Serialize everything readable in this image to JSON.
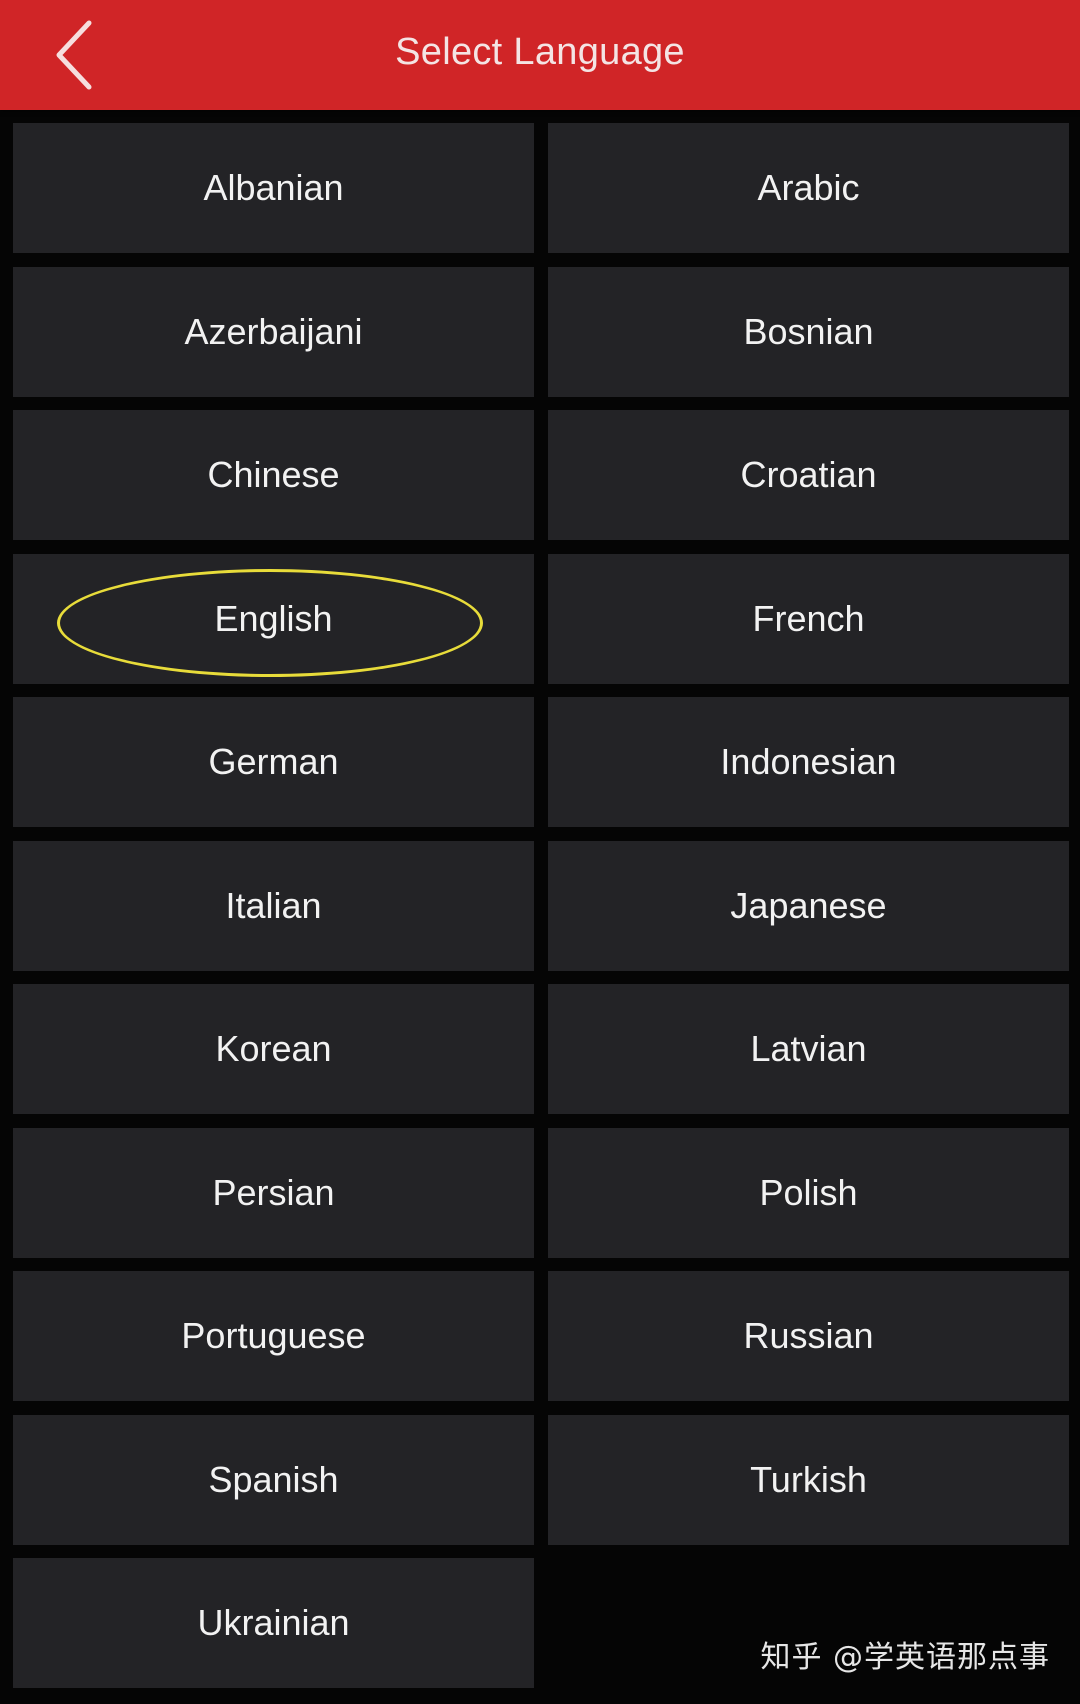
{
  "header": {
    "title": "Select Language",
    "background_color": "#d02527",
    "back_icon": "chevron-left-icon"
  },
  "languages": [
    {
      "label": "Albanian",
      "highlighted": false
    },
    {
      "label": "Arabic",
      "highlighted": false
    },
    {
      "label": "Azerbaijani",
      "highlighted": false
    },
    {
      "label": "Bosnian",
      "highlighted": false
    },
    {
      "label": "Chinese",
      "highlighted": false
    },
    {
      "label": "Croatian",
      "highlighted": false
    },
    {
      "label": "English",
      "highlighted": true
    },
    {
      "label": "French",
      "highlighted": false
    },
    {
      "label": "German",
      "highlighted": false
    },
    {
      "label": "Indonesian",
      "highlighted": false
    },
    {
      "label": "Italian",
      "highlighted": false
    },
    {
      "label": "Japanese",
      "highlighted": false
    },
    {
      "label": "Korean",
      "highlighted": false
    },
    {
      "label": "Latvian",
      "highlighted": false
    },
    {
      "label": "Persian",
      "highlighted": false
    },
    {
      "label": "Polish",
      "highlighted": false
    },
    {
      "label": "Portuguese",
      "highlighted": false
    },
    {
      "label": "Russian",
      "highlighted": false
    },
    {
      "label": "Spanish",
      "highlighted": false
    },
    {
      "label": "Turkish",
      "highlighted": false
    },
    {
      "label": "Ukrainian",
      "highlighted": false
    }
  ],
  "colors": {
    "page_background": "#050505",
    "button_background": "#232326",
    "button_text": "#f2f2f2",
    "highlight_ring": "#e8dc3a"
  },
  "watermark": "知乎 @学英语那点事"
}
